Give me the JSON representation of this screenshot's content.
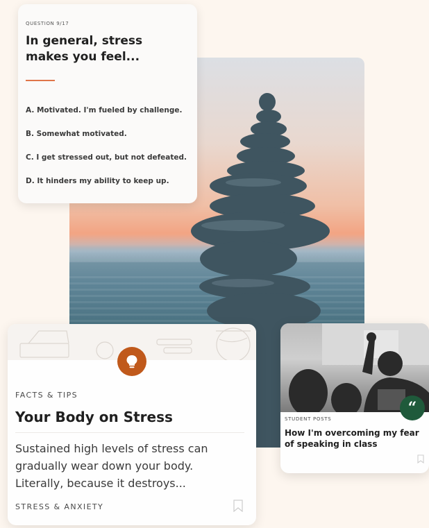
{
  "quiz": {
    "count": "QUESTION 9/17",
    "question": "In general, stress makes you feel...",
    "answers": [
      "A. Motivated. I'm fueled by challenge.",
      "B. Somewhat motivated.",
      "C. I get stressed out, but not defeated.",
      "D. It hinders my ability to keep up."
    ],
    "accent_color": "#e07549"
  },
  "facts_card": {
    "kicker": "FACTS & TIPS",
    "title": "Your Body on Stress",
    "body": "Sustained high levels of stress can gradually wear down your body. Literally, because it destroys...",
    "tag": "STRESS & ANXIETY",
    "icon": "lightbulb-icon",
    "icon_color": "#c0591b"
  },
  "student_card": {
    "kicker": "STUDENT POSTS",
    "title": "How I'm overcoming my fear of speaking in class",
    "badge_icon": "quote-icon",
    "badge_color": "#1f5a3b"
  }
}
